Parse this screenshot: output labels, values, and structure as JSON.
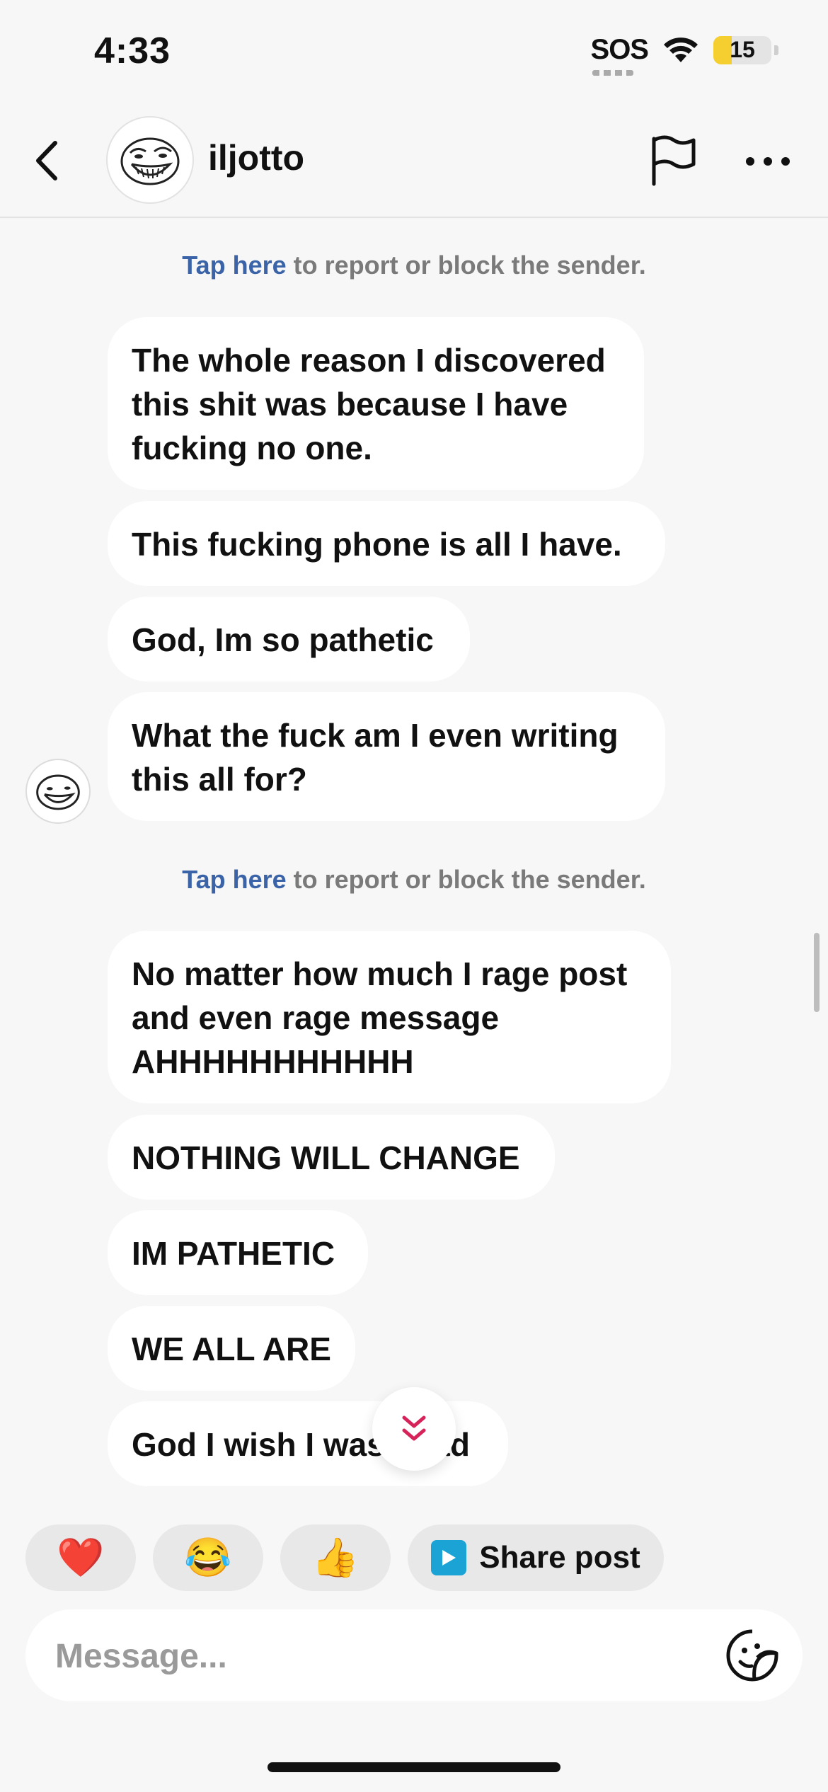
{
  "status_bar": {
    "time": "4:33",
    "sos": "SOS",
    "battery": "15",
    "wifi_icon": "wifi-icon"
  },
  "header": {
    "username": "iljotto",
    "back_icon": "chevron-left-icon",
    "report_icon": "flag-icon",
    "more_icon": "more-horizontal-icon"
  },
  "notice": {
    "link": "Tap here",
    "text": " to report or block the sender."
  },
  "messages_group1": [
    "The whole reason I discovered this shit was because I have fucking no one.",
    "This fucking phone is all I have.",
    "God, Im so pathetic",
    "What the fuck am I even writing this all for?"
  ],
  "messages_group2": [
    "No matter how much I rage post and even rage message AHHHHHHHHHHH",
    "NOTHING WILL CHANGE",
    "IM PATHETIC",
    "WE ALL ARE",
    "God I wish I was dead"
  ],
  "quick_reactions": {
    "heart": "❤️",
    "laugh": "😂",
    "thumbs": "👍",
    "share_label": "Share post"
  },
  "composer": {
    "placeholder": "Message..."
  },
  "colors": {
    "link": "#3a63a8",
    "accent": "#d6245a",
    "battery_fill": "#f5cf2f"
  }
}
